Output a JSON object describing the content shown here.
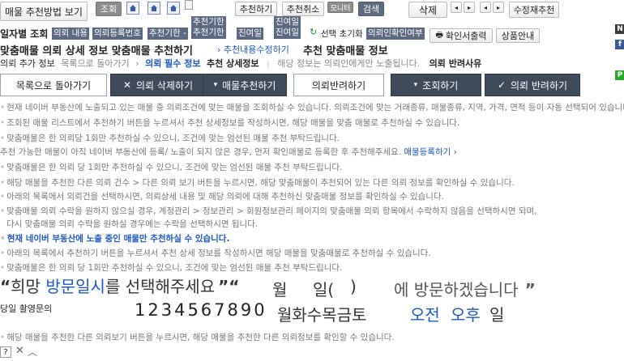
{
  "toolbar": {
    "method_btn": "매물 추천방법 보기",
    "search_btn": "조회",
    "recommend_btn": "추천하기",
    "cancel_btn": "추천취소",
    "monitor_label": "모니터",
    "check_label": "검색",
    "delete_btn": "삭제",
    "edit_btn": "수정재추천"
  },
  "filter_row": {
    "title": "일자별 조회",
    "tags": [
      "의뢰 내용",
      "의뢰등록번호",
      "추천기한 -",
      "추천기한\n추천기한",
      "진여일",
      "진여일\n진여일"
    ],
    "refresh": "선택 초기화",
    "confirm_tag": "의뢰인확인여부",
    "print_btn": "확인서출력",
    "guide_btn": "상품안내"
  },
  "heading": {
    "left": "맞춤매물 의뢰 상세 정보  맞춤매물 추천하기",
    "arrow_link": "추천내용수정하기",
    "right": "추천 맞춤매물 정보"
  },
  "subheading": {
    "add_info": "의뢰 추가 정보",
    "back_link": "목록으로 돌아가기",
    "required": "의뢰 필수 정보",
    "detail": "추천 상세정보",
    "note": "해당 정보는 의뢰인에게만 노출됩니다.",
    "reject_reason": "의뢰 반려사유"
  },
  "actions": {
    "back": "목록으로 돌아가기",
    "delete": "의뢰 삭제하기",
    "recommend": "매물추천하기",
    "reject": "의뢰반려하기",
    "search": "조회하기",
    "reject2": "의뢰 반려하기"
  },
  "info_lines": [
    "현재 네이버 부동산에 노출되고 있는 매물 중 의뢰조건에 맞는 매물을 조회하실 수 있습니다. 의뢰조건에 맞는 거래종류, 매물종류, 지역, 가격, 면적 등이 자동 선택되어 있습니다.",
    "조회된 매물 리스트에서 추천하기 버튼을 누르셔서 추천 상세정보를 작성하시면, 해당 매물을 맞춤 매물로 추천하실 수 있습니다.",
    "맞춤매물은 한 의뢰당 1회만 추천하실 수 있으니, 조건에 맞는 엄선된 매물 추천 부탁드립니다.",
    "추천 가능한 매물이 아직 네이버 부동산에 등록/ 노출이 되지 않은 경우, 먼저 확인매물로 등록한 후 추천해주세요.",
    "맞춤매물은 한 의뢰 당 1회만 추천하실 수 있으니, 조건에 맞는 엄선된 매물 추천 부탁드립니다.",
    "해당 매물을 추천한 다른 의뢰 건수 > 다른 의뢰 보기 버튼을 누르시면, 해당 맞춤매물이 추천되어 있는 다른 의뢰 정보를 확인하실 수 있습니다.",
    "아래의 목록에서 의뢰건을 선택하시면, 의뢰상세 내용 및 해당 의뢰에 대해 추천하신 맞춤매물 정보를 확인하실 수 있습니다.",
    "맞춤매물 의뢰 수락을 원하지 않으실 경우, 계정관리 > 정보관리 > 회원정보관리 페이지의 맞춤매물 의뢰 항목에서 수락하지 않음을 선택하시면 되며,",
    "다시 맞춤매물 의뢰 수락을 원하실 경우에는 수락을 선택하시면 됩니다.",
    "현재 네이버 부동산에 노출 중인 매물만 추천하실 수 있습니다.",
    "아래의 목록에서 추천하기 버튼을 누르셔서 추천 상세 정보를 작성하시면 해당 매물을 맞춤매물로 추천하실 수 있습니다.",
    "맞춤매물은 한 의뢰 당 1회만 추천하실 수 있으니, 조건에 맞는 엄선된 매물 추천 부탁드립니다."
  ],
  "register_link": "매물등록하기",
  "big_line": {
    "q1": "“",
    "p1": "희망 ",
    "p2": "방문일시",
    "p3": "를 선택해주세요",
    "q2": "”",
    "q3": "“",
    "p4": "월",
    "p5": "일(",
    "p6": ")",
    "p7": "에 방문하겠습니다",
    "q4": "”"
  },
  "today_label": "당일 촬영문의",
  "digits": "1234567890",
  "weekdays": "월화수목금토",
  "am": "오전",
  "pm": "오후",
  "day_suffix": "일",
  "footer_line": "해당 매물을 추천한 다른 의뢰보기 버튼을 누르시면, 해당 매물을 추천한 다른 의뢰정보를 확인할 수 있습니다.",
  "side_badges": [
    "N",
    "f",
    "P"
  ],
  "colors": {
    "accent": "#1c56c4",
    "navy": "#3f4b5b",
    "tag": "#5b6a82"
  }
}
